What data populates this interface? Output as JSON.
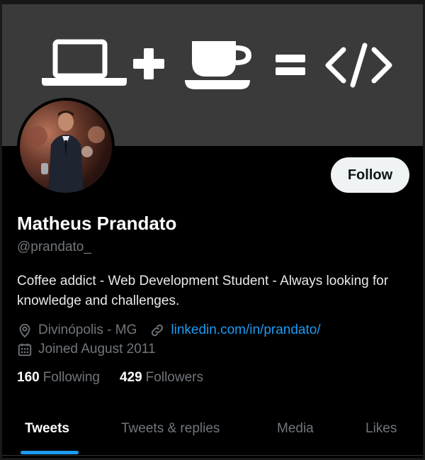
{
  "profile": {
    "name": "Matheus Prandato",
    "handle": "@prandato_",
    "bio": "Coffee addict - Web Development Student - Always looking for knowledge and challenges.",
    "location": "Divinópolis - MG",
    "website": "linkedin.com/in/prandato/",
    "joined": "Joined August 2011",
    "following_count": "160",
    "following_label": "Following",
    "followers_count": "429",
    "followers_label": "Followers"
  },
  "actions": {
    "follow_label": "Follow"
  },
  "tabs": [
    {
      "label": "Tweets",
      "active": true
    },
    {
      "label": "Tweets & replies",
      "active": false
    },
    {
      "label": "Media",
      "active": false
    },
    {
      "label": "Likes",
      "active": false
    }
  ],
  "icons": {
    "location": "location-pin-icon",
    "link": "link-icon",
    "calendar": "calendar-icon"
  },
  "colors": {
    "background": "#000000",
    "banner": "#3a3a3a",
    "accent": "#1d9bf0",
    "muted_text": "#71767b",
    "primary_text": "#e7e9ea"
  }
}
